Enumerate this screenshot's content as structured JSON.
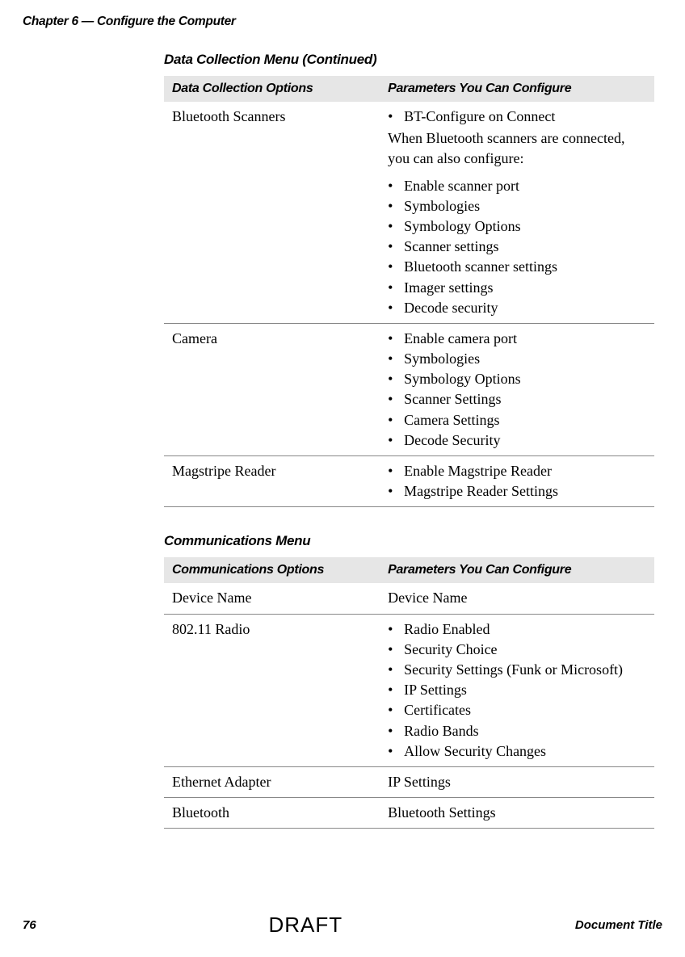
{
  "header": {
    "chapter": "Chapter 6 — Configure the Computer"
  },
  "table1": {
    "title": "Data Collection Menu  (Continued)",
    "col1": "Data Collection Options",
    "col2": "Parameters You Can Configure",
    "rows": [
      {
        "option": "Bluetooth Scanners",
        "intro_bullet": "BT-Configure on Connect",
        "intro_text": "When Bluetooth scanners are connected, you can also configure:",
        "items": [
          "Enable scanner port",
          "Symbologies",
          "Symbology Options",
          "Scanner settings",
          "Bluetooth scanner settings",
          "Imager settings",
          "Decode security"
        ]
      },
      {
        "option": "Camera",
        "items": [
          "Enable camera port",
          "Symbologies",
          "Symbology Options",
          "Scanner Settings",
          "Camera Settings",
          "Decode Security"
        ]
      },
      {
        "option": "Magstripe Reader",
        "items": [
          "Enable Magstripe Reader",
          "Magstripe Reader Settings"
        ]
      }
    ]
  },
  "table2": {
    "title": "Communications Menu",
    "col1": "Communications Options",
    "col2": "Parameters You Can Configure",
    "rows": [
      {
        "option": "Device Name",
        "plain": "Device Name"
      },
      {
        "option": "802.11 Radio",
        "items": [
          "Radio Enabled",
          "Security Choice",
          "Security Settings (Funk or Microsoft)",
          "IP Settings",
          "Certificates",
          "Radio Bands",
          "Allow Security Changes"
        ]
      },
      {
        "option": "Ethernet Adapter",
        "plain": "IP Settings"
      },
      {
        "option": "Bluetooth",
        "plain": "Bluetooth Settings"
      }
    ]
  },
  "footer": {
    "page": "76",
    "watermark": "DRAFT",
    "doc_title": "Document Title"
  }
}
